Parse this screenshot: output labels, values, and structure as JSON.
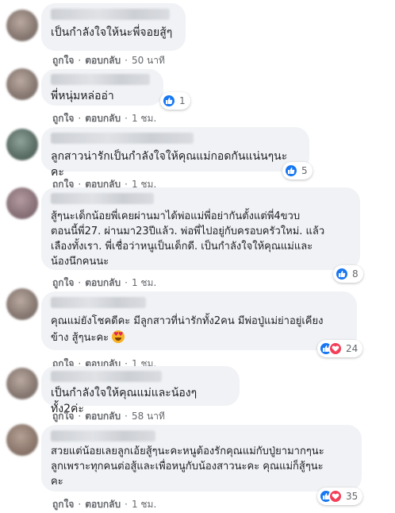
{
  "actions": {
    "like": "ถูกใจ",
    "reply": "ตอบกลับ",
    "separator": "·"
  },
  "comments": [
    {
      "text": "เป็นกำลังใจให้นะพี่จอยสู้ๆ",
      "time": "50 นาที",
      "reaction_count": ""
    },
    {
      "text": "พี่หนุ่มหล่ออ่า",
      "time": "1 ชม.",
      "reaction_count": "1"
    },
    {
      "text": "ลูกสาวน่ารักเป็นกำลังใจให้คุณแม่กอดกันแน่นๆนะคะ",
      "time": "1 ชม.",
      "reaction_count": "5"
    },
    {
      "text": "สู้ๆนะเด็กน้อยพี่เคยผ่านมาได้พ่อแม่พี่อย่ากันตั้งแต่พี่4ขวบ\nตอนนี้พี่27. ผ่านมา23ปีแล้ว. พ่อพี่ไปอยู่กับครอบครัวใหม่. แล้ว\nเลืองทั้งเรา. พี่เชื่อว่าหนูเป็นเด็กดี. เป็นกำลังใจให้คุณแม่และ\nน้องนึกคนนะ",
      "time": "1 ชม.",
      "reaction_count": "8"
    },
    {
      "text": "คุณแม่ยังโชคดีคะ มีลูกสาวที่น่ารักทั้ง2คน มีพ่อปู่แม่ย่าอยู่เคียง\nข้าง สู้ๆนะคะ",
      "time": "1 ชม.",
      "reaction_count": "24"
    },
    {
      "text": "เป็นกำลังใจให้คุณแม่และน้องๆทั้ง2ค่ะ",
      "time": "58 นาที",
      "reaction_count": ""
    },
    {
      "text": "สวยแต่น้อยเลยลูกเอ้ยสู้ๆนะคะหนูต้องรักคุณแม่กับปู่ยามากๆนะ\nลูกเพราะทุกคนต่อสู้และเพื่อหนูกับน้องสาวนะคะ คุณแม่ก็สู้ๆนะ\nคะ",
      "time": "1 ชม.",
      "reaction_count": "35"
    }
  ],
  "icons": {
    "like": "thumbs-up-icon",
    "love": "heart-icon",
    "emoji": "heart-eyes-emoji"
  }
}
